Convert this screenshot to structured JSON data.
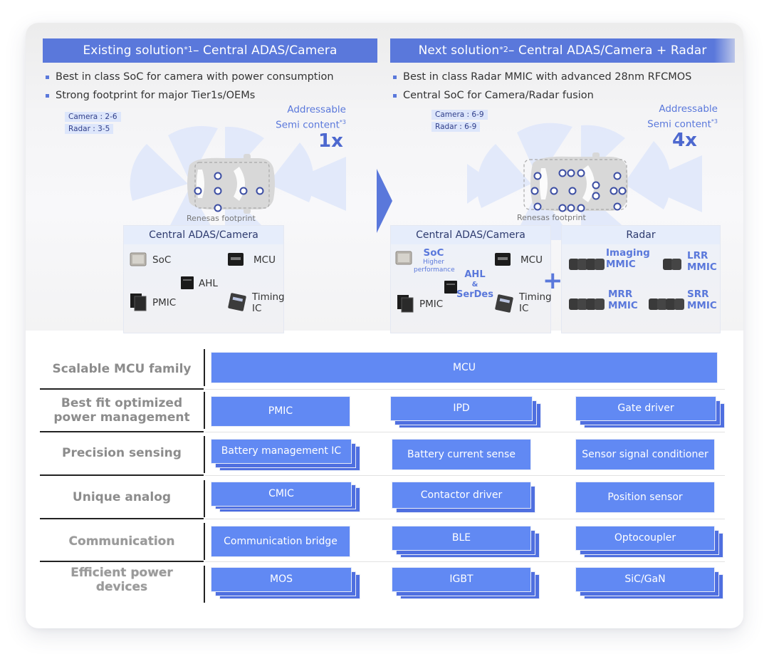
{
  "left_solution": {
    "title_prefix": "Existing solution",
    "title_sup": "*1",
    "title_suffix": " – Central ADAS/Camera",
    "bullets": [
      "Best in class SoC for camera with power consumption",
      "Strong footprint for major Tier1s/OEMs"
    ],
    "camera_count": "Camera : 2-6",
    "radar_count": "Radar : 3-5",
    "addressable_line1": "Addressable",
    "addressable_line2": "Semi content",
    "addressable_sup": "*3",
    "multiplier": "1x",
    "footprint_label": "Renesas footprint",
    "block": {
      "title": "Central ADAS/Camera",
      "items": [
        "SoC",
        "MCU",
        "AHL",
        "PMIC",
        "Timing IC"
      ]
    }
  },
  "right_solution": {
    "title_prefix": "Next solution",
    "title_sup": "*2",
    "title_suffix": " – Central ADAS/Camera + Radar",
    "bullets": [
      "Best in class Radar MMIC with advanced 28nm RFCMOS",
      "Central SoC for Camera/Radar fusion"
    ],
    "camera_count": "Camera : 6-9",
    "radar_count": "Radar : 6-9",
    "addressable_line1": "Addressable",
    "addressable_line2": "Semi content",
    "addressable_sup": "*3",
    "multiplier": "4x",
    "footprint_label": "Renesas footprint",
    "camera_block": {
      "title": "Central ADAS/Camera",
      "soc": "SoC",
      "soc_note": "Higher performance",
      "mcu": "MCU",
      "ahl_line1": "AHL",
      "ahl_line2": "&",
      "ahl_line3": "SerDes",
      "pmic": "PMIC",
      "timing_line1": "Timing",
      "timing_line2": "IC"
    },
    "plus_symbol": "+",
    "radar_block": {
      "title": "Radar",
      "items": [
        {
          "line1": "Imaging",
          "line2": "MMIC"
        },
        {
          "line1": "LRR",
          "line2": "MMIC"
        },
        {
          "line1": "MRR",
          "line2": "MMIC"
        },
        {
          "line1": "SRR",
          "line2": "MMIC"
        }
      ]
    }
  },
  "portfolio": {
    "rows": [
      {
        "label": "Scalable MCU family",
        "items": [
          "MCU"
        ]
      },
      {
        "label": "Best fit optimized power management",
        "items": [
          "PMIC",
          "IPD",
          "Gate driver"
        ]
      },
      {
        "label": "Precision sensing",
        "items": [
          "Battery management IC",
          "Battery current sense",
          "Sensor signal conditioner"
        ]
      },
      {
        "label": "Unique analog",
        "items": [
          "CMIC",
          "Contactor driver",
          "Position sensor"
        ]
      },
      {
        "label": "Communication",
        "items": [
          "Communication bridge",
          "BLE",
          "Optocoupler"
        ]
      },
      {
        "label": "Efficient power devices",
        "items": [
          "MOS",
          "IGBT",
          "SiC/GaN"
        ]
      }
    ]
  },
  "colors": {
    "header_blue": "#5a78db",
    "box_blue": "#6189f3",
    "box_shadow_blue": "#4f6fe0",
    "label_gray": "#8c8c8c"
  }
}
